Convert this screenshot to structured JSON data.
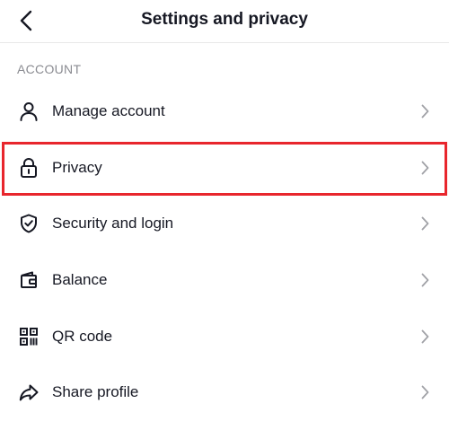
{
  "header": {
    "title": "Settings and privacy",
    "back_icon": "chevron-left-icon"
  },
  "section": {
    "label": "ACCOUNT"
  },
  "items": [
    {
      "label": "Manage account",
      "icon": "person-icon"
    },
    {
      "label": "Privacy",
      "icon": "lock-icon"
    },
    {
      "label": "Security and login",
      "icon": "shield-check-icon"
    },
    {
      "label": "Balance",
      "icon": "wallet-icon"
    },
    {
      "label": "QR code",
      "icon": "qr-code-icon"
    },
    {
      "label": "Share profile",
      "icon": "share-arrow-icon"
    }
  ],
  "colors": {
    "text": "#161823",
    "muted": "#8a8b91",
    "chevron": "#a1a2a7",
    "highlight": "#e8262d"
  }
}
